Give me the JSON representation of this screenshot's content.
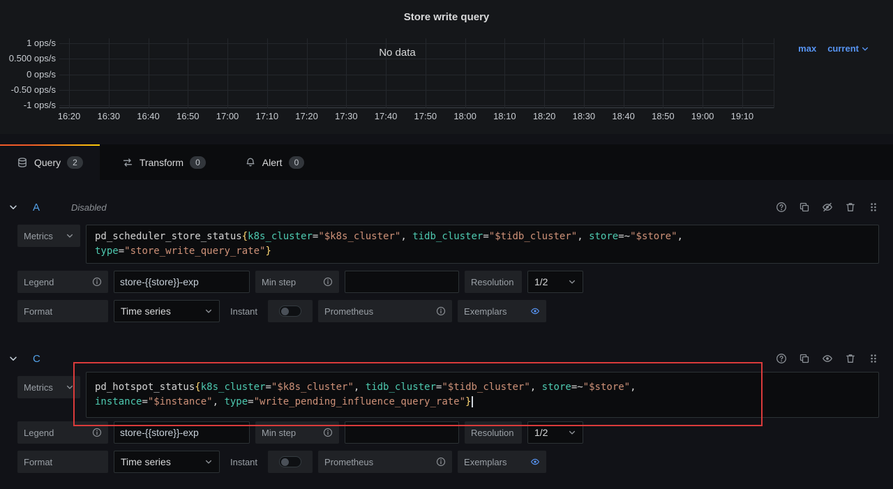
{
  "panel": {
    "title": "Store write query",
    "no_data": "No data",
    "legend": [
      "max",
      "current"
    ]
  },
  "chart_data": {
    "type": "line",
    "title": "Store write query",
    "series": [],
    "no_data": true,
    "x_ticks": [
      "16:20",
      "16:30",
      "16:40",
      "16:50",
      "17:00",
      "17:10",
      "17:20",
      "17:30",
      "17:40",
      "17:50",
      "18:00",
      "18:10",
      "18:20",
      "18:30",
      "18:40",
      "18:50",
      "19:00",
      "19:10"
    ],
    "y_ticks": [
      "1 ops/s",
      "0.500 ops/s",
      "0 ops/s",
      "-0.50 ops/s",
      "-1 ops/s"
    ],
    "ylim": [
      -1,
      1
    ],
    "ylabel": "ops/s",
    "grid": true,
    "legend_position": "top-right",
    "legend_items": [
      "max",
      "current"
    ]
  },
  "tabs": {
    "query": {
      "label": "Query",
      "count": "2"
    },
    "transform": {
      "label": "Transform",
      "count": "0"
    },
    "alert": {
      "label": "Alert",
      "count": "0"
    }
  },
  "editor_labels": {
    "metrics": "Metrics",
    "legend": "Legend",
    "min_step": "Min step",
    "resolution": "Resolution",
    "resolution_value": "1/2",
    "format": "Format",
    "format_value": "Time series",
    "instant": "Instant",
    "prometheus": "Prometheus",
    "exemplars": "Exemplars"
  },
  "queries": {
    "a": {
      "ref": "A",
      "status": "Disabled",
      "legend_value": "store-{{store}}-exp",
      "min_step_value": "",
      "code": [
        [
          [
            "metric",
            "pd_scheduler_store_status"
          ],
          [
            "brace",
            "{"
          ],
          [
            "label",
            "k8s_cluster"
          ],
          [
            "op",
            "="
          ],
          [
            "str",
            "\"$k8s_cluster\""
          ],
          [
            "op",
            ", "
          ],
          [
            "label",
            "tidb_cluster"
          ],
          [
            "op",
            "="
          ],
          [
            "str",
            "\"$tidb_cluster\""
          ],
          [
            "op",
            ", "
          ],
          [
            "label",
            "store"
          ],
          [
            "op",
            "=~"
          ],
          [
            "str",
            "\"$store\""
          ],
          [
            "op",
            ","
          ]
        ],
        [
          [
            "label",
            "type"
          ],
          [
            "op",
            "="
          ],
          [
            "str",
            "\"store_write_query_rate\""
          ],
          [
            "brace",
            "}"
          ]
        ]
      ]
    },
    "c": {
      "ref": "C",
      "legend_value": "store-{{store}}-exp",
      "min_step_value": "",
      "code": [
        [
          [
            "metric",
            "pd_hotspot_status"
          ],
          [
            "brace",
            "{"
          ],
          [
            "label",
            "k8s_cluster"
          ],
          [
            "op",
            "="
          ],
          [
            "str",
            "\"$k8s_cluster\""
          ],
          [
            "op",
            ", "
          ],
          [
            "label",
            "tidb_cluster"
          ],
          [
            "op",
            "="
          ],
          [
            "str",
            "\"$tidb_cluster\""
          ],
          [
            "op",
            ", "
          ],
          [
            "label",
            "store"
          ],
          [
            "op",
            "=~"
          ],
          [
            "str",
            "\"$store\""
          ],
          [
            "op",
            ","
          ]
        ],
        [
          [
            "label",
            "instance"
          ],
          [
            "op",
            "="
          ],
          [
            "str",
            "\"$instance\""
          ],
          [
            "op",
            ", "
          ],
          [
            "label",
            "type"
          ],
          [
            "op",
            "="
          ],
          [
            "str",
            "\"write_pending_influence_query_rate\""
          ],
          [
            "brace",
            "}"
          ],
          [
            "cursor",
            ""
          ]
        ]
      ]
    }
  },
  "colors": {
    "accent_blue": "#5794f2",
    "ref_blue": "#53a1e8",
    "annotation_red": "#da3b3b",
    "tab_gradient_start": "#f05a28",
    "tab_gradient_end": "#fbca0a",
    "syntax_label": "#4ec9b0",
    "syntax_string": "#ce9178",
    "syntax_brace": "#ffd773"
  }
}
